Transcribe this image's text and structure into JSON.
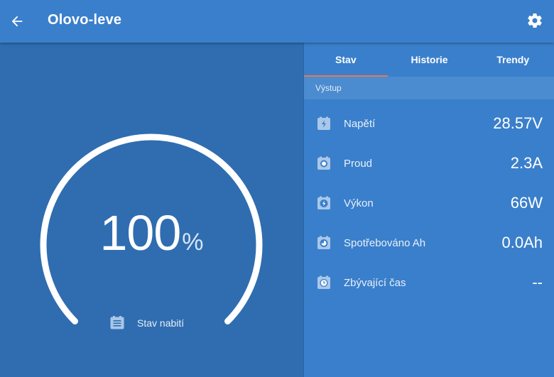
{
  "header": {
    "title": "Olovo-leve",
    "back_icon": "arrow-left-icon",
    "settings_icon": "gear-icon"
  },
  "gauge": {
    "value": "100",
    "unit": "%",
    "fraction": 1.0,
    "label": "Stav nabití",
    "label_icon": "list-icon"
  },
  "tabs": [
    {
      "label": "Stav",
      "active": true
    },
    {
      "label": "Historie",
      "active": false
    },
    {
      "label": "Trendy",
      "active": false
    }
  ],
  "section": {
    "title": "Výstup"
  },
  "rows": [
    {
      "label": "Napětí",
      "value": "28.57V",
      "icon": "voltage-bolt-icon"
    },
    {
      "label": "Proud",
      "value": "2.3A",
      "icon": "current-dot-icon"
    },
    {
      "label": "Výkon",
      "value": "66W",
      "icon": "power-bolt-icon"
    },
    {
      "label": "Spotřebováno Ah",
      "value": "0.0Ah",
      "icon": "consumed-pie-icon"
    },
    {
      "label": "Zbývající čas",
      "value": "--",
      "icon": "clock-icon"
    }
  ],
  "colors": {
    "topbar": "#3a7fcb",
    "left_panel": "#2f6db0",
    "right_panel": "#3a7fcb",
    "tab_indicator": "#e8794e",
    "section_bg": "#4b8bd0"
  }
}
